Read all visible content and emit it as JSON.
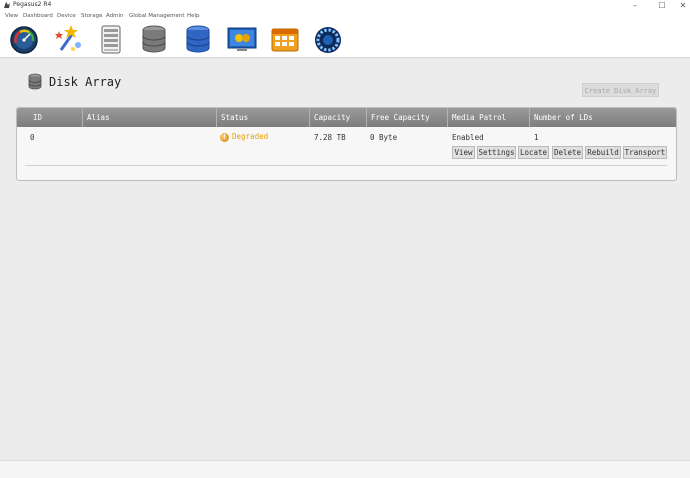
{
  "window": {
    "title": "Pegasus2 R4",
    "minimize": "–",
    "maximize": "☐",
    "close": "✕"
  },
  "menu": [
    "View",
    "Dashboard",
    "Device",
    "Storage",
    "Admin",
    "Global Management",
    "Help"
  ],
  "toolbar": {
    "icons": [
      "dashboard-gauge-icon",
      "wizard-icon",
      "device-icon",
      "storage-icon",
      "disk-array-icon",
      "monitor-admin-icon",
      "calendar-icon",
      "global-management-icon"
    ]
  },
  "page": {
    "title": "Disk Array",
    "create_button": "Create Disk Array"
  },
  "table": {
    "columns": [
      "ID",
      "Alias",
      "Status",
      "Capacity",
      "Free Capacity",
      "Media Patrol",
      "Number of LDs"
    ],
    "rows": [
      {
        "id": "0",
        "alias": "",
        "status": "Degraded",
        "capacity": "7.28 TB",
        "free_capacity": "0 Byte",
        "media_patrol": "Enabled",
        "number_of_lds": "1"
      }
    ],
    "actions": [
      "View",
      "Settings",
      "Locate",
      "Delete",
      "Rebuild",
      "Transport"
    ]
  },
  "colors": {
    "status_degraded": "#e8a000",
    "header_bg": "#8a8a8a",
    "accent_blue": "#1f5fb4"
  }
}
